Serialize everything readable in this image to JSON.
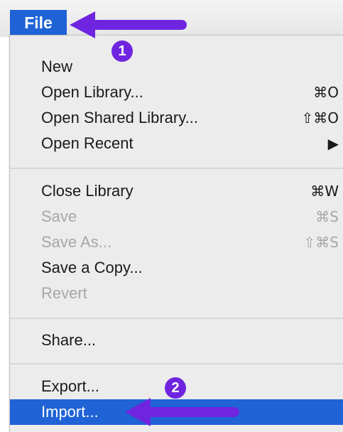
{
  "menu": {
    "title": "File",
    "items": [
      {
        "label": "New",
        "shortcut": ""
      },
      {
        "label": "Open Library...",
        "shortcut": "⌘O"
      },
      {
        "label": "Open Shared Library...",
        "shortcut": "⇧⌘O"
      },
      {
        "label": "Open Recent",
        "shortcut": "▶"
      },
      {
        "label": "Close Library",
        "shortcut": "⌘W"
      },
      {
        "label": "Save",
        "shortcut": "⌘S",
        "disabled": true
      },
      {
        "label": "Save As...",
        "shortcut": "⇧⌘S",
        "disabled": true
      },
      {
        "label": "Save a Copy...",
        "shortcut": ""
      },
      {
        "label": "Revert",
        "shortcut": "",
        "disabled": true
      },
      {
        "label": "Share...",
        "shortcut": ""
      },
      {
        "label": "Export...",
        "shortcut": ""
      },
      {
        "label": "Import...",
        "shortcut": "",
        "highlighted": true
      }
    ]
  },
  "annotations": {
    "step1": "1",
    "step2": "2",
    "arrow_color": "#6f25e0"
  },
  "colors": {
    "highlight": "#1f63d6",
    "disabled_text": "#a7a7a7",
    "menu_background": "#ececec"
  }
}
